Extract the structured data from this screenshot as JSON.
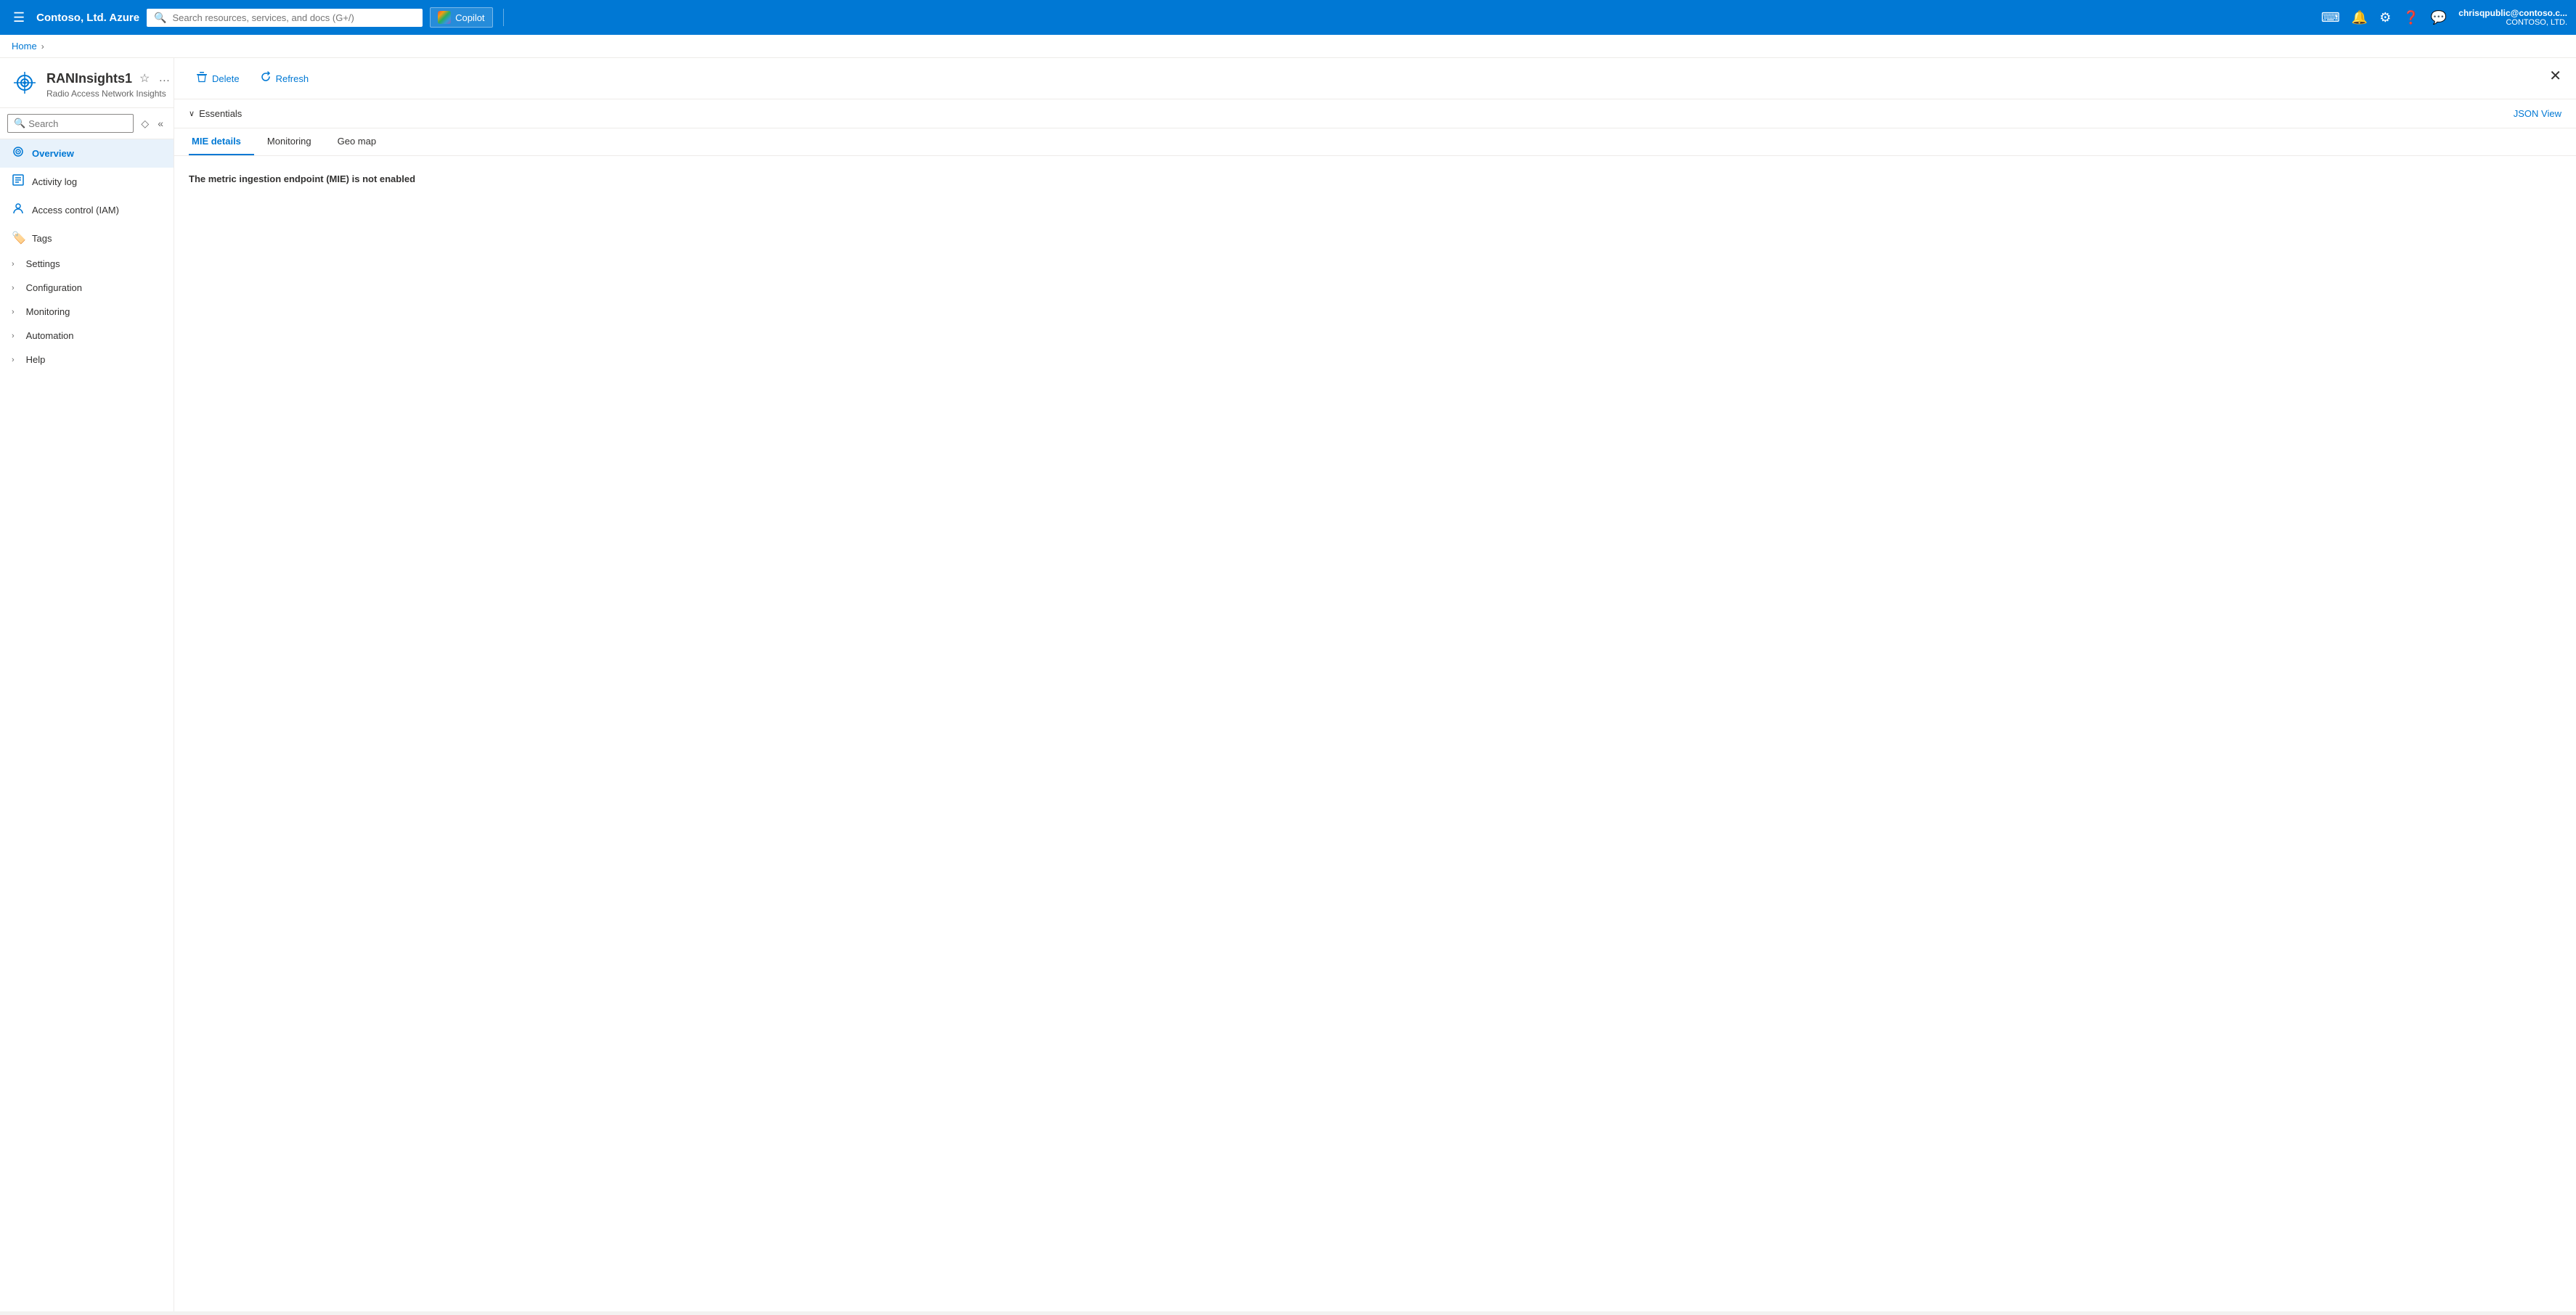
{
  "topnav": {
    "brand": "Contoso, Ltd. Azure",
    "search_placeholder": "Search resources, services, and docs (G+/)",
    "copilot_label": "Copilot",
    "user_name": "chrisqpublic@contoso.c...",
    "user_org": "CONTOSO, LTD."
  },
  "breadcrumb": {
    "home_label": "Home",
    "separator": "›"
  },
  "resource": {
    "title": "RANInsights1",
    "subtitle": "Radio Access Network Insights"
  },
  "sidebar": {
    "search_placeholder": "Search",
    "items": [
      {
        "id": "overview",
        "label": "Overview",
        "icon": "📡",
        "active": true,
        "expandable": false
      },
      {
        "id": "activity-log",
        "label": "Activity log",
        "icon": "📋",
        "active": false,
        "expandable": false
      },
      {
        "id": "access-control",
        "label": "Access control (IAM)",
        "icon": "👥",
        "active": false,
        "expandable": false
      },
      {
        "id": "tags",
        "label": "Tags",
        "icon": "🏷️",
        "active": false,
        "expandable": false
      },
      {
        "id": "settings",
        "label": "Settings",
        "icon": "",
        "active": false,
        "expandable": true
      },
      {
        "id": "configuration",
        "label": "Configuration",
        "icon": "",
        "active": false,
        "expandable": true
      },
      {
        "id": "monitoring",
        "label": "Monitoring",
        "icon": "",
        "active": false,
        "expandable": true
      },
      {
        "id": "automation",
        "label": "Automation",
        "icon": "",
        "active": false,
        "expandable": true
      },
      {
        "id": "help",
        "label": "Help",
        "icon": "",
        "active": false,
        "expandable": true
      }
    ]
  },
  "toolbar": {
    "delete_label": "Delete",
    "refresh_label": "Refresh"
  },
  "essentials": {
    "label": "Essentials",
    "json_view_label": "JSON View"
  },
  "tabs": [
    {
      "id": "mie-details",
      "label": "MIE details",
      "active": true
    },
    {
      "id": "monitoring",
      "label": "Monitoring",
      "active": false
    },
    {
      "id": "geo-map",
      "label": "Geo map",
      "active": false
    }
  ],
  "mie_content": {
    "message": "The metric ingestion endpoint (MIE) is not enabled"
  }
}
